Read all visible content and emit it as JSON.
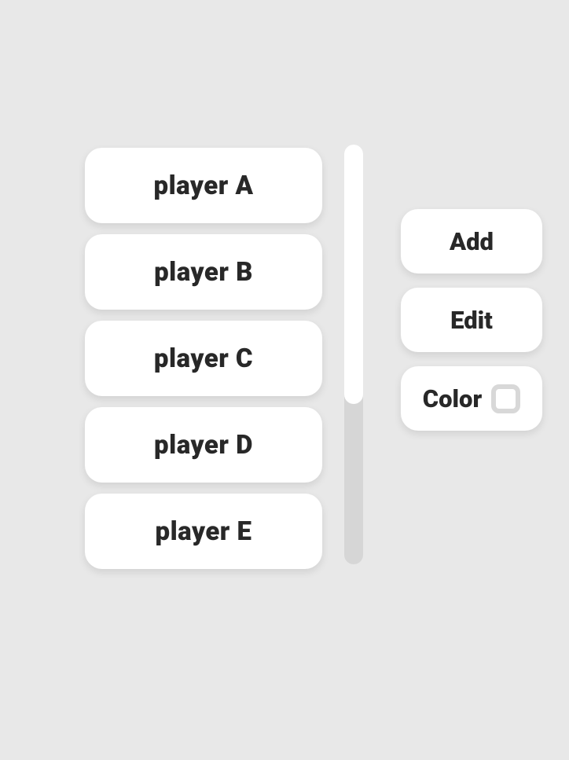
{
  "players": [
    {
      "name": "player A"
    },
    {
      "name": "player B"
    },
    {
      "name": "player C"
    },
    {
      "name": "player D"
    },
    {
      "name": "player E"
    }
  ],
  "actions": {
    "add_label": "Add",
    "edit_label": "Edit",
    "color_label": "Color"
  }
}
